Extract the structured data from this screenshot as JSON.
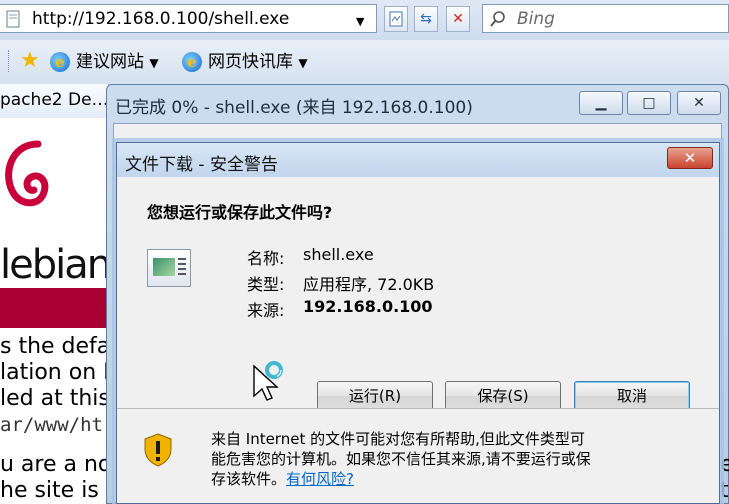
{
  "browser": {
    "url": "http://192.168.0.100/shell.exe",
    "search_placeholder": "Bing",
    "favorites": [
      "建议网站",
      "网页快讯库"
    ],
    "tab_label": "pache2 De…"
  },
  "page": {
    "logo_word": "lebian",
    "lines": [
      "s the defa",
      "lation on D",
      "led at this",
      "ar/www/ht",
      "u are a norr",
      "he site is c"
    ],
    "right_glyphs": [
      "e",
      "t"
    ]
  },
  "outer_window": {
    "title": "已完成 0% - shell.exe (来自 192.168.0.100)"
  },
  "dialog": {
    "title": "文件下载 - 安全警告",
    "question": "您想运行或保存此文件吗?",
    "file": {
      "name_label": "名称:",
      "name_value": "shell.exe",
      "type_label": "类型:",
      "type_value": "应用程序, 72.0KB",
      "source_label": "来源:",
      "source_value": "192.168.0.100"
    },
    "buttons": {
      "run": "运行(R)",
      "save": "保存(S)",
      "cancel": "取消"
    },
    "warning": {
      "line1": "来自 Internet 的文件可能对您有所帮助,但此文件类型可",
      "line2": "能危害您的计算机。如果您不信任其来源,请不要运行或保",
      "line3": "存该软件。",
      "link": "有何风险?"
    }
  },
  "colors": {
    "debian_red": "#a80030",
    "link": "#0066cc",
    "close_red": "#c8452e"
  }
}
